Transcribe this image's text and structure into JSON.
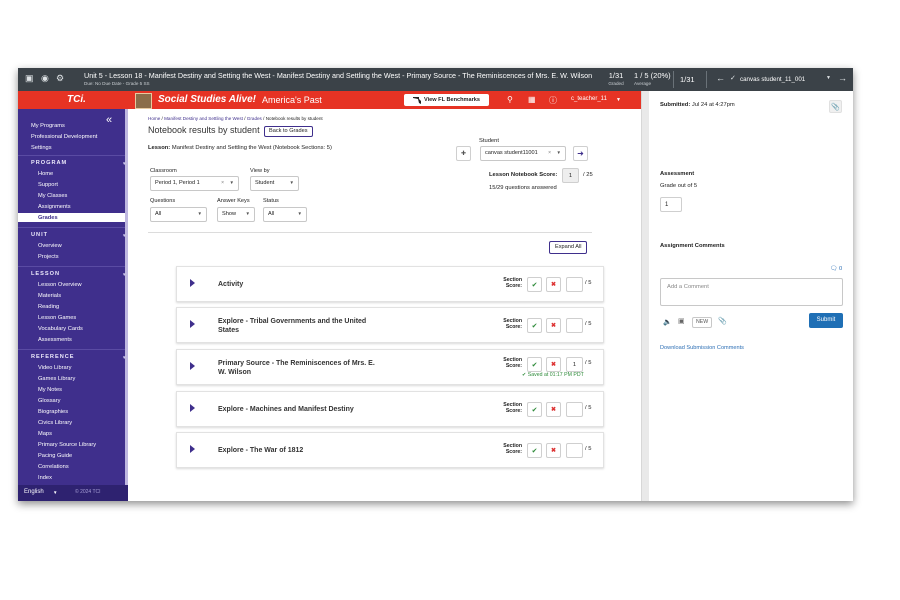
{
  "topbar": {
    "title": "Unit 5 - Lesson 18 - Manifest Destiny and Setting the West - Manifest Destiny and Settling the West - Primary Source - The Reminiscences of Mrs. E. W. Wilson",
    "subtitle": "Due: No Due Date - Grade 5 SS",
    "graded_value": "1/31",
    "graded_label": "Graded",
    "average_value": "1 / 5 (20%)",
    "average_label": "Average",
    "position": "1/31",
    "student": "canvas student_11_001",
    "icons": [
      "document-icon",
      "eye-icon",
      "gear-icon",
      "back-arrow-icon",
      "check-icon",
      "chevron-down-icon",
      "forward-arrow-icon"
    ]
  },
  "header": {
    "logo": "TCi.",
    "program": "Social Studies Alive!",
    "program_sub": "America's Past",
    "benchmarks_button": "View FL Benchmarks",
    "user": "c_teacher_11"
  },
  "sidebar": {
    "top": [
      "My Programs",
      "Professional Development",
      "Settings"
    ],
    "program_heading": "PROGRAM",
    "program": [
      "Home",
      "Support",
      "My Classes",
      "Assignments",
      "Grades"
    ],
    "active": "Grades",
    "unit_heading": "UNIT",
    "unit": [
      "Overview",
      "Projects"
    ],
    "lesson_heading": "LESSON",
    "lesson": [
      "Lesson Overview",
      "Materials",
      "Reading",
      "Lesson Games",
      "Vocabulary Cards",
      "Assessments"
    ],
    "reference_heading": "REFERENCE",
    "reference": [
      "Video Library",
      "Games Library",
      "My Notes",
      "Glossary",
      "Biographies",
      "Civics Library",
      "Maps",
      "Primary Source Library",
      "Pacing Guide",
      "Correlations",
      "Index"
    ],
    "language": "English",
    "copyright": "© 2024 TCI",
    "colors": {
      "sidebar": "#3f2f8c",
      "header": "#e63324"
    }
  },
  "main": {
    "breadcrumb_home": "Home",
    "breadcrumb_lesson": "Manifest Destiny and Settling the West",
    "breadcrumb_grades": "Grades",
    "breadcrumb_current": "Notebook results by student",
    "page_title": "Notebook results by student",
    "back_button": "Back to Grades",
    "lesson_label": "Lesson:",
    "lesson_value": "Manifest Destiny and Settling the West (Notebook Sections: 5)",
    "student_label": "Student",
    "student_value": "canvas student11001",
    "notebook_score_label": "Lesson Notebook Score:",
    "notebook_score_value": "1",
    "notebook_score_total": "/ 25",
    "questions_answered": "15/29 questions answered",
    "classroom_label": "Classroom",
    "classroom_value": "Period 1, Period 1",
    "viewby_label": "View by",
    "viewby_value": "Student",
    "questions_label": "Questions",
    "questions_value": "All",
    "answerkeys_label": "Answer Keys",
    "answerkeys_value": "Show",
    "status_label": "Status",
    "status_value": "All",
    "expand_all": "Expand All",
    "section_score_label": "Section Score:",
    "sections": [
      {
        "title": "Activity",
        "score": "",
        "total": "/ 5",
        "saved": ""
      },
      {
        "title": "Explore - Tribal Governments and the United States",
        "score": "",
        "total": "/ 5",
        "saved": ""
      },
      {
        "title": "Primary Source - The Reminiscences of Mrs. E. W. Wilson",
        "score": "1",
        "total": "/ 5",
        "saved": "Saved at 01:17 PM PDT"
      },
      {
        "title": "Explore - Machines and Manifest Destiny",
        "score": "",
        "total": "/ 5",
        "saved": ""
      },
      {
        "title": "Explore - The War of 1812",
        "score": "",
        "total": "/ 5",
        "saved": ""
      }
    ]
  },
  "right_panel": {
    "submitted_label": "Submitted:",
    "submitted_value": "Jul 24 at 4:27pm",
    "assessment_label": "Assessment",
    "grade_out_of": "Grade out of 5",
    "grade_value": "1",
    "comments_label": "Assignment Comments",
    "comment_count": "0",
    "comment_placeholder": "Add a Comment",
    "new_badge": "NEW",
    "submit_button": "Submit",
    "download_link": "Download Submission Comments"
  }
}
